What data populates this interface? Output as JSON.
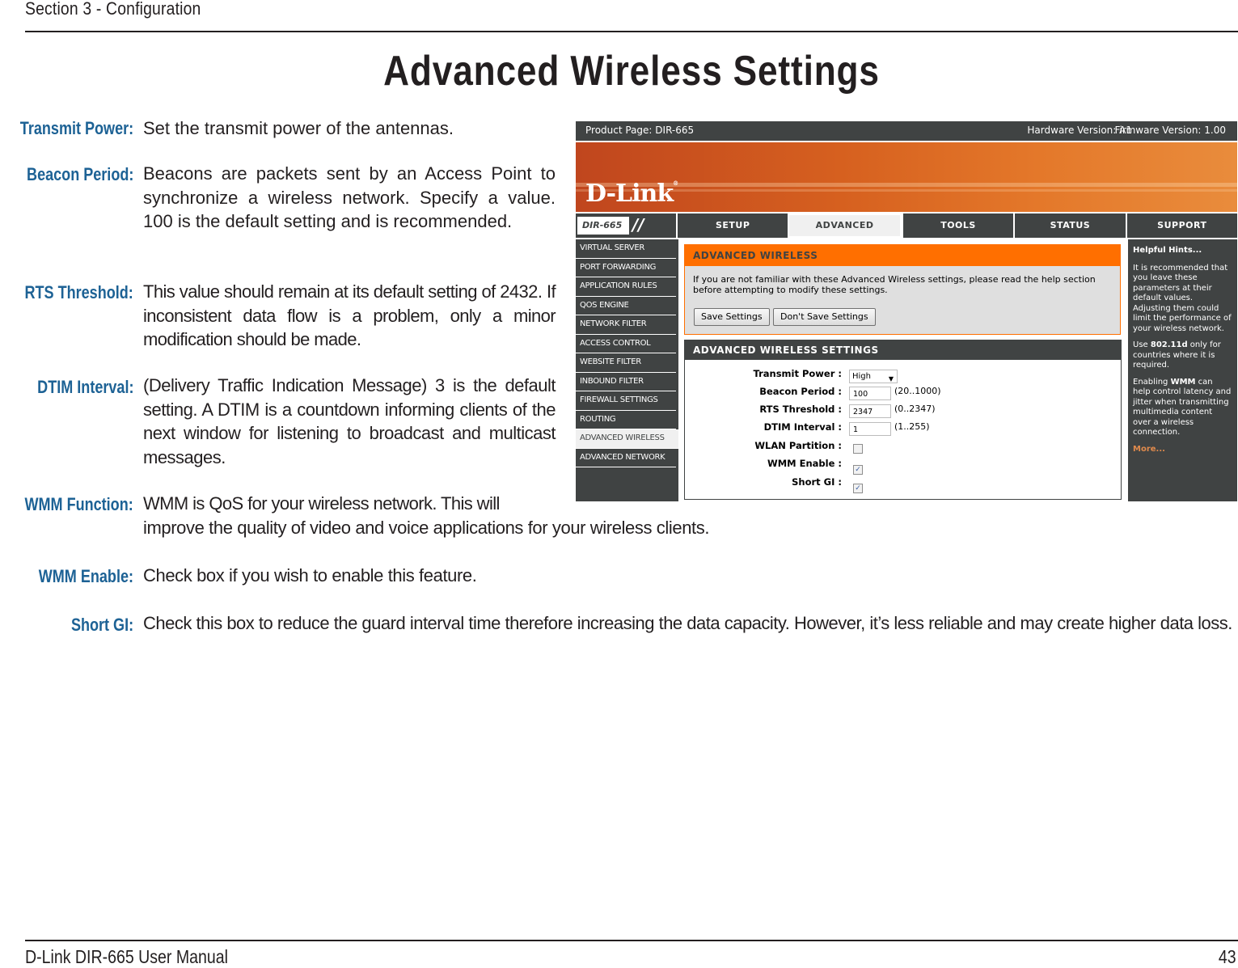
{
  "page": {
    "section_header": "Section 3 - Configuration",
    "title": "Advanced Wireless Settings",
    "footer_left": "D-Link DIR-665 User Manual",
    "footer_page_number": "43",
    "term_color": "#1d6295"
  },
  "definitions": [
    {
      "term": "Transmit Power:",
      "description": "Set the transmit power of the antennas."
    },
    {
      "term": "Beacon Period:",
      "description": "Beacons are packets sent by an Access Point to synchronize a wireless network. Specify a value. 100 is the default setting and is recommended."
    },
    {
      "term": "RTS Threshold:",
      "description": "This value should remain at its default setting of 2432. If inconsistent data flow is a problem, only a minor modification should be made."
    },
    {
      "term": "DTIM Interval:",
      "description": "(Delivery Traffic Indication Message) 3 is the default setting. A DTIM is a countdown informing clients of the next window for listening to broadcast and multicast messages."
    },
    {
      "term": "WMM Function:",
      "description_line1": "WMM is QoS for your wireless network. This will",
      "description_line2": "improve the quality of video and voice applications for your wireless clients."
    },
    {
      "term": "WMM Enable:",
      "description": "Check box if you wish to enable this feature."
    },
    {
      "term": "Short GI:",
      "description": "Check this box to reduce the guard interval time therefore increasing the data capacity.  However, it’s less reliable and may create higher data loss."
    }
  ],
  "router_ui": {
    "topbar": {
      "product_page": "Product Page: DIR-665",
      "hardware_version": "Hardware Version: A1",
      "firmware_version": "Firmware Version: 1.00"
    },
    "logo": "D-Link",
    "logo_mark": "®",
    "model_badge": "DIR-665",
    "model_slash": "//",
    "tabs": [
      {
        "label": "SETUP",
        "active": false
      },
      {
        "label": "ADVANCED",
        "active": true
      },
      {
        "label": "TOOLS",
        "active": false
      },
      {
        "label": "STATUS",
        "active": false
      },
      {
        "label": "SUPPORT",
        "active": false
      }
    ],
    "sidebar": [
      {
        "label": "VIRTUAL SERVER"
      },
      {
        "label": "PORT FORWARDING"
      },
      {
        "label": "APPLICATION RULES"
      },
      {
        "label": "QOS ENGINE"
      },
      {
        "label": "NETWORK FILTER"
      },
      {
        "label": "ACCESS CONTROL"
      },
      {
        "label": "WEBSITE FILTER"
      },
      {
        "label": "INBOUND FILTER"
      },
      {
        "label": "FIREWALL SETTINGS"
      },
      {
        "label": "ROUTING"
      },
      {
        "label": "ADVANCED WIRELESS",
        "active": true
      },
      {
        "label": "ADVANCED NETWORK"
      }
    ],
    "intro": {
      "heading": "ADVANCED WIRELESS",
      "text": "If you are not familiar with these Advanced Wireless settings, please read the help section before attempting to modify these settings.",
      "save_button": "Save Settings",
      "dont_save_button": "Don't Save Settings"
    },
    "settings": {
      "heading": "ADVANCED WIRELESS SETTINGS",
      "transmit_power": {
        "label": "Transmit Power :",
        "value": "High"
      },
      "beacon_period": {
        "label": "Beacon Period :",
        "value": "100",
        "range": "(20..1000)"
      },
      "rts_threshold": {
        "label": "RTS Threshold :",
        "value": "2347",
        "range": "(0..2347)"
      },
      "dtim_interval": {
        "label": "DTIM Interval :",
        "value": "1",
        "range": "(1..255)"
      },
      "wlan_partition": {
        "label": "WLAN Partition :",
        "checked": false
      },
      "wmm_enable": {
        "label": "WMM Enable :",
        "checked": true
      },
      "short_gi": {
        "label": "Short GI :",
        "checked": true
      }
    },
    "hints": {
      "heading": "Helpful Hints...",
      "p1": "It is recommended that you leave these parameters at their default values. Adjusting them could limit the performance of your wireless network.",
      "p2_prefix": "Use ",
      "p2_bold": "802.11d",
      "p2_suffix": " only for countries where it is required.",
      "p3_prefix": "Enabling ",
      "p3_bold": "WMM",
      "p3_suffix": " can help control latency and jitter when transmitting multimedia content over a wireless connection.",
      "more_link": "More..."
    },
    "colors": {
      "dark_gray": "#404343",
      "orange": "#ff6f00",
      "banner_orange": "#d6601f",
      "hint_link": "#e08a4c"
    }
  }
}
